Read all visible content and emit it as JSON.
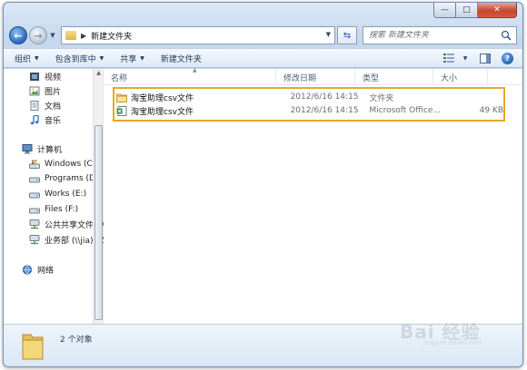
{
  "window": {
    "caption_buttons": {
      "minimize": "—",
      "maximize": "□",
      "close": "✕"
    }
  },
  "address": {
    "path": "新建文件夹",
    "search_placeholder": "搜索 新建文件夹"
  },
  "commands": {
    "organize": "组织",
    "include_library": "包含到库中",
    "share": "共享",
    "new_folder": "新建文件夹"
  },
  "navigation": {
    "libraries": [
      {
        "label": "视频",
        "icon": "video-icon"
      },
      {
        "label": "图片",
        "icon": "picture-icon"
      },
      {
        "label": "文档",
        "icon": "document-icon"
      },
      {
        "label": "音乐",
        "icon": "music-icon"
      }
    ],
    "computer": {
      "label": "计算机",
      "drives": [
        {
          "label": "Windows (C:)",
          "icon": "windows-drive-icon"
        },
        {
          "label": "Programs (D:)",
          "icon": "drive-icon"
        },
        {
          "label": "Works (E:)",
          "icon": "drive-icon"
        },
        {
          "label": "Files (F:)",
          "icon": "drive-icon"
        },
        {
          "label": "公共共享文件 (\\\\",
          "icon": "network-drive-icon"
        },
        {
          "label": "业务部 (\\\\jia) (Z:",
          "icon": "network-drive-icon"
        }
      ]
    },
    "network": "网络"
  },
  "columns": {
    "name": "名称",
    "modified": "修改日期",
    "type": "类型",
    "size": "大小"
  },
  "files": [
    {
      "name": "淘宝助理csv文件",
      "modified": "2012/6/16 14:15",
      "type": "文件夹",
      "size": "",
      "icon": "folder-icon"
    },
    {
      "name": "淘宝助理csv文件",
      "modified": "2012/6/16 14:15",
      "type": "Microsoft Office...",
      "size": "49 KB",
      "icon": "excel-file-icon"
    }
  ],
  "details": {
    "count": "2 个对象"
  },
  "watermark": {
    "text": "Bai 经验",
    "sub": "jingyan.baidu.com"
  },
  "colors": {
    "selection_border": "#e6a92a",
    "window_frame": "#c6d8ee"
  }
}
